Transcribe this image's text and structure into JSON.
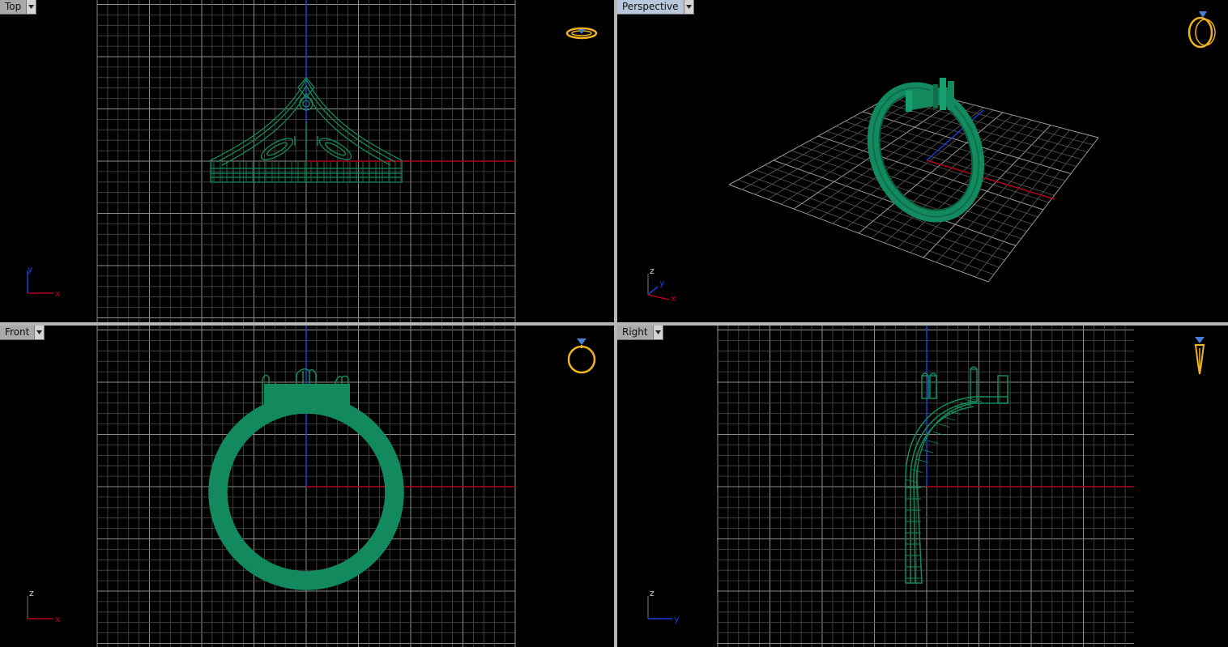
{
  "viewports": {
    "top": {
      "label": "Top",
      "axis_h": "x",
      "axis_v": "y",
      "menu_icon": "chevron-down-icon"
    },
    "perspective": {
      "label": "Perspective",
      "axis_1": "z",
      "axis_2": "y",
      "axis_3": "x",
      "menu_icon": "chevron-down-icon"
    },
    "front": {
      "label": "Front",
      "axis_h": "x",
      "axis_v": "z",
      "menu_icon": "chevron-down-icon"
    },
    "right": {
      "label": "Right",
      "axis_h": "y",
      "axis_v": "z",
      "menu_icon": "chevron-down-icon"
    }
  },
  "colors": {
    "background": "#000000",
    "grid": "#5a5a5a",
    "grid_major": "#8c8c8c",
    "axis_x": "#b0001a",
    "axis_y": "#1a3fd8",
    "model": "#138a5e",
    "gizmo": "#f2b21a",
    "gizmo_gem": "#4a7fd6",
    "label_bg": "#a9a9a9"
  },
  "icons": {
    "view_gizmo": "ring-view-gizmo-icon"
  }
}
